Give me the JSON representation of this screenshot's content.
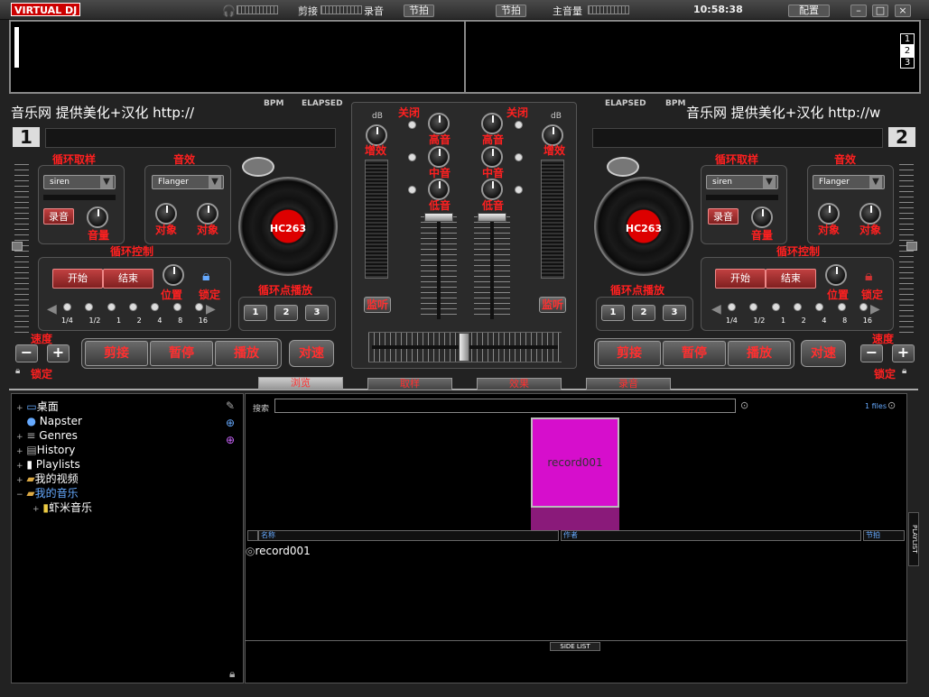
{
  "app": {
    "logo": "VIRTUAL DJ",
    "clock": "10:58:38"
  },
  "top": {
    "cut_label": "剪接",
    "rec_label": "录音",
    "beat_label": "节拍",
    "beat2_label": "节拍",
    "master_label": "主音量",
    "config_label": "配置"
  },
  "waveform": {
    "pages": [
      "1",
      "2",
      "3"
    ]
  },
  "deck1": {
    "scroll_text": "音乐网 提供美化+汉化 http://",
    "bpm": "BPM",
    "elapsed": "ELAPSED",
    "number": "1",
    "loop_sample": "循环取样",
    "fx": "音效",
    "sample_sel": "siren",
    "fx_sel": "Flanger",
    "record": "录音",
    "volume": "音量",
    "target1": "对象",
    "target2": "对象",
    "loop_ctrl": "循环控制",
    "start": "开始",
    "end": "结束",
    "position": "位置",
    "lock": "锁定",
    "loop_sizes": [
      "1/4",
      "1/2",
      "1",
      "2",
      "4",
      "8",
      "16"
    ],
    "cue_play": "循环点播放",
    "cues": [
      "1",
      "2",
      "3"
    ],
    "speed": "速度",
    "cut": "剪接",
    "pause": "暂停",
    "play": "播放",
    "sync": "对速",
    "lock2": "锁定",
    "platter": "HC263"
  },
  "deck2": {
    "scroll_text": "音乐网 提供美化+汉化 http://w",
    "bpm": "BPM",
    "elapsed": "ELAPSED",
    "number": "2",
    "loop_sample": "循环取样",
    "fx": "音效",
    "sample_sel": "siren",
    "fx_sel": "Flanger",
    "record": "录音",
    "volume": "音量",
    "target1": "对象",
    "target2": "对象",
    "loop_ctrl": "循环控制",
    "start": "开始",
    "end": "结束",
    "position": "位置",
    "lock": "锁定",
    "loop_sizes": [
      "1/4",
      "1/2",
      "1",
      "2",
      "4",
      "8",
      "16"
    ],
    "cue_play": "循环点播放",
    "cues": [
      "1",
      "2",
      "3"
    ],
    "speed": "速度",
    "cut": "剪接",
    "pause": "暂停",
    "play": "播放",
    "sync": "对速",
    "lock2": "锁定",
    "platter": "HC263"
  },
  "mixer": {
    "db": "dB",
    "gain": "增效",
    "close": "关闭",
    "high": "高音",
    "mid": "中音",
    "low": "低音",
    "monitor": "监听"
  },
  "tabs": [
    "浏览",
    "取样",
    "效果",
    "录音"
  ],
  "browser": {
    "tree": [
      "桌面",
      "Napster",
      "Genres",
      "History",
      "Playlists",
      "我的视频",
      "我的音乐",
      "虾米音乐"
    ],
    "search_label": "搜索",
    "files_count": "1 files",
    "cover_text": "record001",
    "columns": [
      "名称",
      "作者",
      "节拍"
    ],
    "rows": [
      "record001"
    ],
    "side_list": "SIDE LIST",
    "playlist": "PLAYLIST"
  }
}
